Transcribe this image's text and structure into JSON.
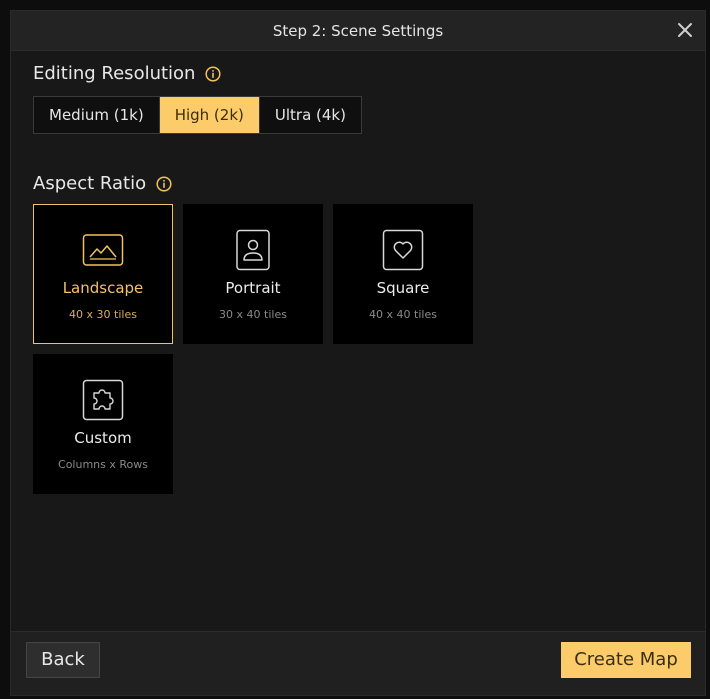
{
  "dialog": {
    "title": "Step 2: Scene Settings"
  },
  "resolution": {
    "label": "Editing Resolution",
    "options": [
      "Medium (1k)",
      "High (2k)",
      "Ultra (4k)"
    ],
    "selected": "High (2k)"
  },
  "aspect": {
    "label": "Aspect Ratio",
    "options": [
      {
        "name": "Landscape",
        "sub": "40 x 30 tiles",
        "icon": "landscape-icon"
      },
      {
        "name": "Portrait",
        "sub": "30 x 40 tiles",
        "icon": "portrait-icon"
      },
      {
        "name": "Square",
        "sub": "40 x 40 tiles",
        "icon": "heart-icon"
      },
      {
        "name": "Custom",
        "sub": "Columns x Rows",
        "icon": "puzzle-icon"
      }
    ],
    "selected": "Landscape"
  },
  "footer": {
    "back_label": "Back",
    "create_label": "Create Map"
  },
  "colors": {
    "accent": "#fdcc6a",
    "selected_text": "#f5c266",
    "background": "#181818"
  }
}
